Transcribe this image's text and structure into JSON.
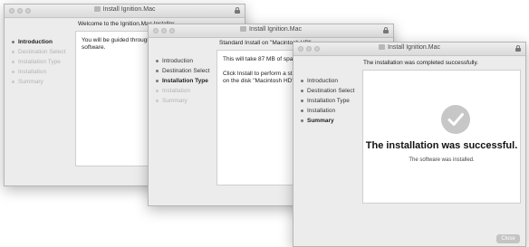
{
  "window1": {
    "title": "Install Ignition.Mac",
    "heading": "Welcome to the Ignition.Mac Installer",
    "steps": [
      {
        "label": "Introduction"
      },
      {
        "label": "Destination Select"
      },
      {
        "label": "Installation Type"
      },
      {
        "label": "Installation"
      },
      {
        "label": "Summary"
      }
    ],
    "body": "You will be guided through the steps necessary to install this\nsoftware."
  },
  "window2": {
    "title": "Install Ignition.Mac",
    "heading": "Standard Install on \"Macintosh HD\"",
    "steps": [
      {
        "label": "Introduction"
      },
      {
        "label": "Destination Select"
      },
      {
        "label": "Installation Type"
      },
      {
        "label": "Installation"
      },
      {
        "label": "Summary"
      }
    ],
    "body": "This will take 87 MB of space on your computer.\n\nClick Install to perform a standard installation of this software\non the disk \"Macintosh HD\"."
  },
  "window3": {
    "title": "Install Ignition.Mac",
    "heading": "The installation was completed successfully.",
    "steps": [
      {
        "label": "Introduction"
      },
      {
        "label": "Destination Select"
      },
      {
        "label": "Installation Type"
      },
      {
        "label": "Installation"
      },
      {
        "label": "Summary"
      }
    ],
    "success_title": "The installation was successful.",
    "success_sub": "The software was installed.",
    "close_button": "Close"
  }
}
